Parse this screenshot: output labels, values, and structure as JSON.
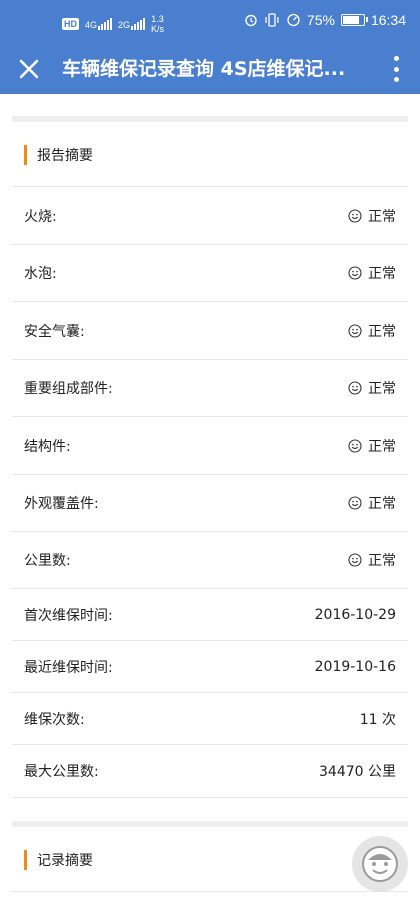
{
  "status_bar": {
    "badge": "HD",
    "signal1": "4G",
    "signal2": "2G",
    "net_speed_value": "1.3",
    "net_speed_unit": "K/s",
    "battery": "75%",
    "battery_level": 0.75,
    "time": "16:34"
  },
  "header": {
    "title": "车辆维保记录查询 4S店维保记..."
  },
  "report_summary": {
    "heading": "报告摘要",
    "items": [
      {
        "label": "火烧:",
        "value": "正常"
      },
      {
        "label": "水泡:",
        "value": "正常"
      },
      {
        "label": "安全气囊:",
        "value": "正常"
      },
      {
        "label": "重要组成部件:",
        "value": "正常"
      },
      {
        "label": "结构件:",
        "value": "正常"
      },
      {
        "label": "外观覆盖件:",
        "value": "正常"
      },
      {
        "label": "公里数:",
        "value": "正常"
      },
      {
        "label": "首次维保时间:",
        "value": "2016-10-29"
      },
      {
        "label": "最近维保时间:",
        "value": "2019-10-16"
      },
      {
        "label": "维保次数:",
        "value": "11 次"
      },
      {
        "label": "最大公里数:",
        "value": "34470 公里"
      }
    ]
  },
  "record_summary": {
    "heading": "记录摘要"
  },
  "colors": {
    "brand_blue": "#4a7fcf",
    "accent_orange": "#f08a1c"
  },
  "icons": {
    "close": "close-icon",
    "more": "more-vert-icon",
    "smile": "smile-icon",
    "fab": "assistant-face-icon"
  }
}
